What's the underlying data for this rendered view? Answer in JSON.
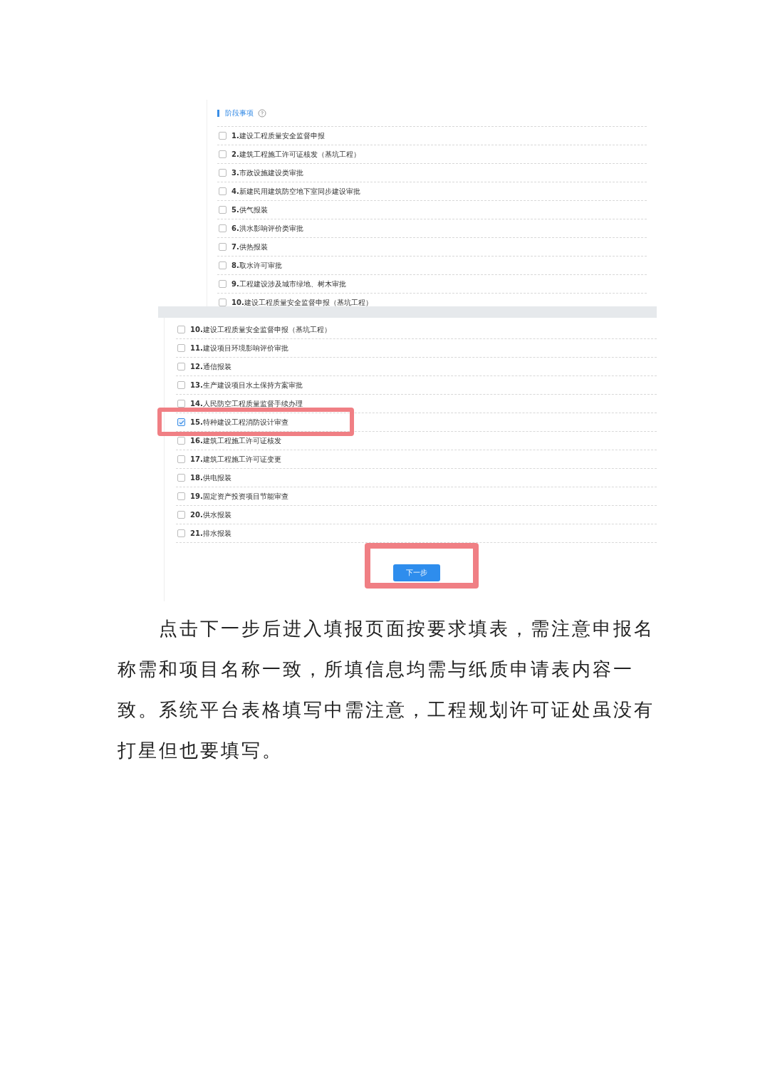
{
  "top_panel": {
    "title": "阶段事项",
    "items": [
      {
        "label": "**1.**建设工程质量安全监督申报",
        "checked": false
      },
      {
        "label": "**2.**建筑工程施工许可证核发（基坑工程）",
        "checked": false
      },
      {
        "label": "**3.**市政设施建设类审批",
        "checked": false
      },
      {
        "label": "**4.**新建民用建筑防空地下室同步建设审批",
        "checked": false
      },
      {
        "label": "**5.**供气报装",
        "checked": false
      },
      {
        "label": "**6.**洪水影响评价类审批",
        "checked": false
      },
      {
        "label": "**7.**供热报装",
        "checked": false
      },
      {
        "label": "**8.**取水许可审批",
        "checked": false
      },
      {
        "label": "**9.**工程建设涉及城市绿地、树木审批",
        "checked": false
      },
      {
        "label": "**10.**建设工程质量安全监督申报（基坑工程）",
        "checked": false
      }
    ]
  },
  "bottom_panel": {
    "items": [
      {
        "label": "**10.**建设工程质量安全监督申报（基坑工程）",
        "checked": false,
        "highlighted": false
      },
      {
        "label": "**11.**建设项目环境影响评价审批",
        "checked": false,
        "highlighted": false
      },
      {
        "label": "**12.**通信报装",
        "checked": false,
        "highlighted": false
      },
      {
        "label": "**13.**生产建设项目水土保持方案审批",
        "checked": false,
        "highlighted": false
      },
      {
        "label": "**14.**人民防空工程质量监督手续办理",
        "checked": false,
        "highlighted": false
      },
      {
        "label": "**15.**特种建设工程消防设计审查",
        "checked": true,
        "highlighted": true
      },
      {
        "label": "**16.**建筑工程施工许可证核发",
        "checked": false,
        "highlighted": false
      },
      {
        "label": "**17.**建筑工程施工许可证变更",
        "checked": false,
        "highlighted": false
      },
      {
        "label": "**18.**供电报装",
        "checked": false,
        "highlighted": false
      },
      {
        "label": "**19.**固定资产投资项目节能审查",
        "checked": false,
        "highlighted": false
      },
      {
        "label": "**20.**供水报装",
        "checked": false,
        "highlighted": false
      },
      {
        "label": "**21.**排水报装",
        "checked": false,
        "highlighted": false
      }
    ],
    "button": {
      "label": "下一步",
      "highlighted": true
    }
  },
  "paragraph": "点击下一步后进入填报页面按要求填表，需注意申报名称需和项目名称一致，所填信息均需与纸质申请表内容一致。系统平台表格填写中需注意，工程规划许可证处虽没有打星但也要填写。"
}
